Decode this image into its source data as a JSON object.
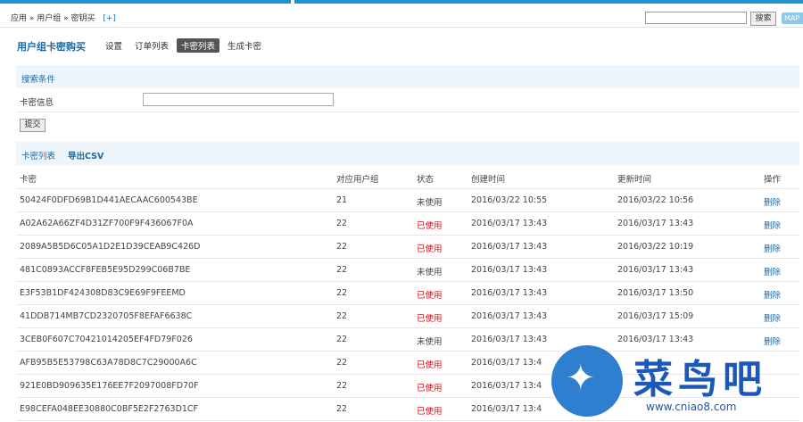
{
  "breadcrumb": {
    "text": "应用 » 用户组 » 密钥买",
    "add": "[+]"
  },
  "top_search": {
    "button": "搜索",
    "map": "MAP"
  },
  "title": "用户组卡密购买",
  "subnav": [
    "设置",
    "订单列表",
    "卡密列表",
    "生成卡密"
  ],
  "filter_section": {
    "title": "搜索条件",
    "field_label": "卡密信息",
    "submit": "提交"
  },
  "list_section": {
    "title": "卡密列表",
    "export": "导出CSV"
  },
  "table": {
    "headers": [
      "卡密",
      "对应用户组",
      "状态",
      "创建时间",
      "更新时间",
      "操作"
    ],
    "rows": [
      [
        "50424F0DFD69B1D441AECAAC600543BE",
        "21",
        "未使用",
        "2016/03/22 10:55",
        "2016/03/22 10:56",
        "删除"
      ],
      [
        "A02A62A66ZF4D31ZF700F9F436067F0A",
        "22",
        "已使用",
        "2016/03/17 13:43",
        "2016/03/17 13:43",
        "删除"
      ],
      [
        "2089A5B5D6C05A1D2E1D39CEAB9C426D",
        "22",
        "已使用",
        "2016/03/17 13:43",
        "2016/03/22 10:19",
        "删除"
      ],
      [
        "481C0893ACCF8FEB5E95D299C06B7BE",
        "22",
        "未使用",
        "2016/03/17 13:43",
        "2016/03/17 13:43",
        "删除"
      ],
      [
        "E3F53B1DF424308D83C9E69F9FEEMD",
        "22",
        "已使用",
        "2016/03/17 13:43",
        "2016/03/17 13:50",
        "删除"
      ],
      [
        "41DDB714MB7CD2320705F8EFAF6638C",
        "22",
        "已使用",
        "2016/03/17 13:43",
        "2016/03/17 15:09",
        "删除"
      ],
      [
        "3CEB0F607C70421014205EF4FD79F026",
        "22",
        "未使用",
        "2016/03/17 13:43",
        "2016/03/17 13:43",
        "删除"
      ],
      [
        "AFB95B5E53798C63A78D8C7C29000A6C",
        "22",
        "已使用",
        "2016/03/17 13:4",
        "",
        ""
      ],
      [
        "921E0BD909635E176EE7F2097008FD70F",
        "22",
        "已使用",
        "2016/03/17 13:4",
        "",
        ""
      ],
      [
        "E98CEFA048EE30880C0BF5E2F2763D1CF",
        "22",
        "已使用",
        "2016/03/17 13:4",
        "",
        ""
      ]
    ]
  },
  "watermark": {
    "text": "菜鸟吧",
    "url": "www.cniao8.com"
  }
}
